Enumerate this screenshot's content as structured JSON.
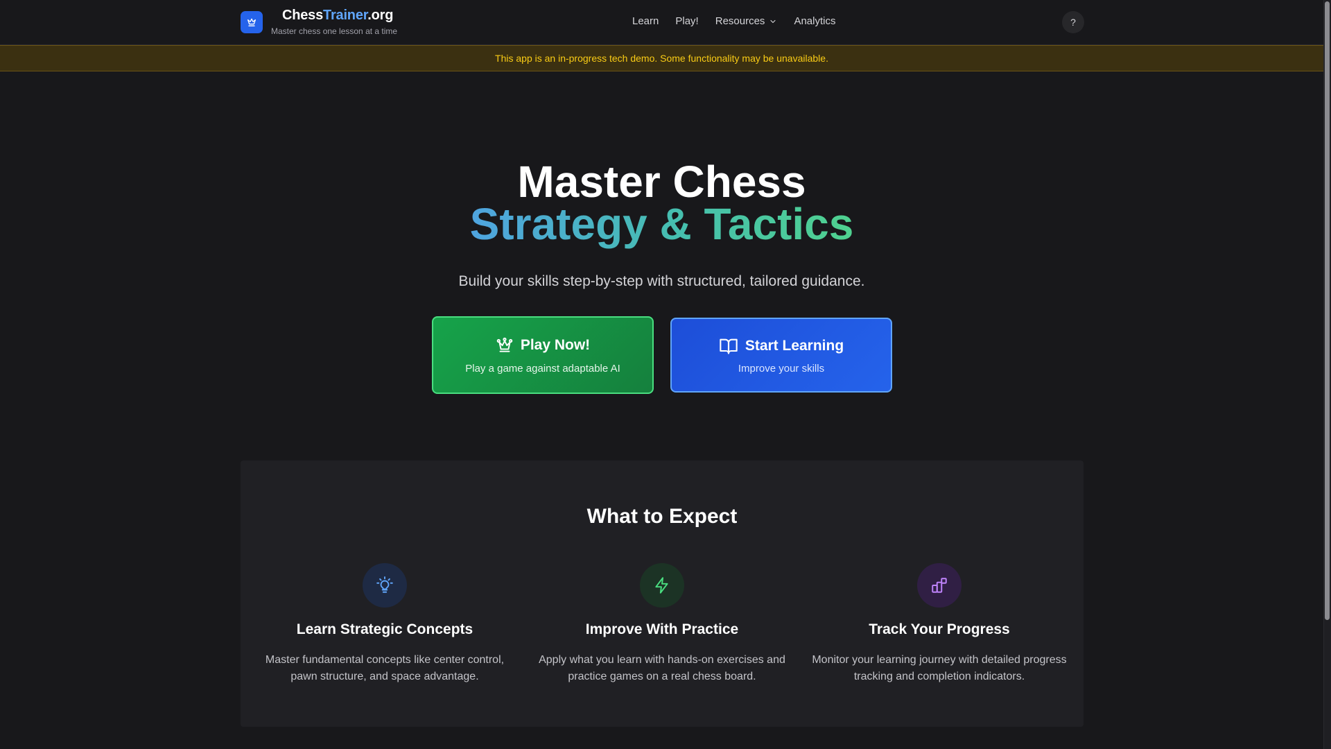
{
  "header": {
    "brand_main": "Chess",
    "brand_accent": "Trainer",
    "brand_suffix": ".org",
    "tagline": "Master chess one lesson at a time",
    "nav": [
      {
        "label": "Learn"
      },
      {
        "label": "Play!"
      },
      {
        "label": "Resources"
      },
      {
        "label": "Analytics"
      }
    ],
    "help_label": "?"
  },
  "banner": {
    "text": "This app is an in-progress tech demo. Some functionality may be unavailable."
  },
  "hero": {
    "title_line1": "Master Chess",
    "title_line2": "Strategy & Tactics",
    "subtitle": "Build your skills step-by-step with structured, tailored guidance.",
    "play_button": {
      "label": "Play Now!",
      "sub": "Play a game against adaptable AI",
      "icon": "chess-queen-icon"
    },
    "learn_button": {
      "label": "Start Learning",
      "sub": "Improve your skills",
      "icon": "open-book-icon"
    }
  },
  "features": {
    "title": "What to Expect",
    "items": [
      {
        "title": "Learn Strategic Concepts",
        "desc": "Master fundamental concepts like center control, pawn structure, and space advantage.",
        "icon": "lightbulb-icon",
        "color": "#60a5fa"
      },
      {
        "title": "Improve With Practice",
        "desc": "Apply what you learn with hands-on exercises and practice games on a real chess board.",
        "icon": "lightning-icon",
        "color": "#4ade80"
      },
      {
        "title": "Track Your Progress",
        "desc": "Monitor your learning journey with detailed progress tracking and completion indicators.",
        "icon": "progress-blocks-icon",
        "color": "#c084fc"
      }
    ]
  },
  "colors": {
    "background": "#18181b",
    "brand_blue": "#2563eb",
    "play_green": "#16a34a",
    "banner_text": "#facc15"
  }
}
